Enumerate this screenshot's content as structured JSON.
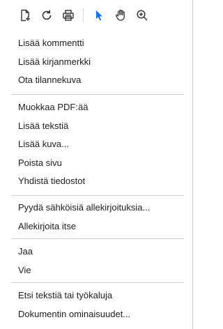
{
  "toolbar": {
    "icons": [
      {
        "name": "export-pdf-icon"
      },
      {
        "name": "refresh-icon"
      },
      {
        "name": "print-icon"
      },
      {
        "name": "select-cursor-icon",
        "color": "#1473e6"
      },
      {
        "name": "hand-tool-icon"
      },
      {
        "name": "zoom-in-icon"
      }
    ]
  },
  "menu": {
    "group1": [
      "Lisää kommentti",
      "Lisää kirjanmerkki",
      "Ota tilannekuva"
    ],
    "group2": [
      "Muokkaa PDF:ää",
      "Lisää tekstiä",
      "Lisää kuva...",
      "Poista sivu",
      "Yhdistä tiedostot"
    ],
    "group3": [
      "Pyydä sähköisiä allekirjoituksia...",
      "Allekirjoita itse"
    ],
    "group4": [
      "Jaa",
      "Vie"
    ],
    "group5": [
      "Etsi tekstiä tai työkaluja",
      "Dokumentin ominaisuudet..."
    ]
  }
}
